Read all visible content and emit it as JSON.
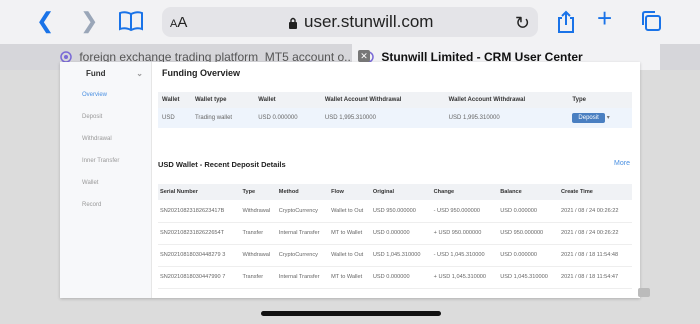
{
  "browser": {
    "text_size_label": "AA",
    "url": "user.stunwill.com"
  },
  "tabs": [
    {
      "title": "foreign exchange trading platform_MT5 account o...",
      "active": false
    },
    {
      "title": "Stunwill Limited - CRM User Center",
      "active": true
    }
  ],
  "sidebar": {
    "header": "Fund",
    "items": [
      {
        "label": "Overview",
        "active": true
      },
      {
        "label": "Deposit",
        "active": false
      },
      {
        "label": "Withdrawal",
        "active": false
      },
      {
        "label": "Inner Transfer",
        "active": false
      },
      {
        "label": "Wallet",
        "active": false
      },
      {
        "label": "Record",
        "active": false
      }
    ]
  },
  "overview": {
    "title": "Funding Overview",
    "headers": [
      "Wallet",
      "Wallet type",
      "Wallet",
      "Wallet Account Withdrawal",
      "Wallet Account Withdrawal",
      "Type"
    ],
    "row": {
      "wallet": "USD",
      "wallet_type": "Trading wallet",
      "balance": "USD 0.000000",
      "acct_withdrawal_1": "USD 1,995.310000",
      "acct_withdrawal_2": "USD 1,995.310000",
      "action": "Deposit"
    }
  },
  "deposits": {
    "title": "USD Wallet - Recent Deposit Details",
    "more": "More",
    "headers": [
      "Serial Number",
      "Type",
      "Method",
      "Flow",
      "Original",
      "Change",
      "Balance",
      "Create Time"
    ],
    "rows": [
      [
        "SN20210823182623417B",
        "Withdrawal",
        "CryptoCurrency",
        "Wallet to Out",
        "USD 950.000000",
        "- USD 950.000000",
        "USD 0.000000",
        "2021 / 08 / 24 00:26:22"
      ],
      [
        "SN20210823182622654T",
        "Transfer",
        "Internal Transfer",
        "MT to Wallet",
        "USD 0.000000",
        "+ USD 950.000000",
        "USD 950.000000",
        "2021 / 08 / 24 00:26:22"
      ],
      [
        "SN20210818030448279 3",
        "Withdrawal",
        "CryptoCurrency",
        "Wallet to Out",
        "USD 1,045.310000",
        "- USD 1,045.310000",
        "USD 0.000000",
        "2021 / 08 / 18 11:54:48"
      ],
      [
        "SN20210818030447990 7",
        "Transfer",
        "Internal Transfer",
        "MT to Wallet",
        "USD 0.000000",
        "+ USD 1,045.310000",
        "USD 1,045.310000",
        "2021 / 08 / 18 11:54:47"
      ]
    ]
  },
  "colors": {
    "accent": "#4a90e2",
    "button": "#4a7fc1",
    "toolbar_blue": "#1a73e8"
  }
}
